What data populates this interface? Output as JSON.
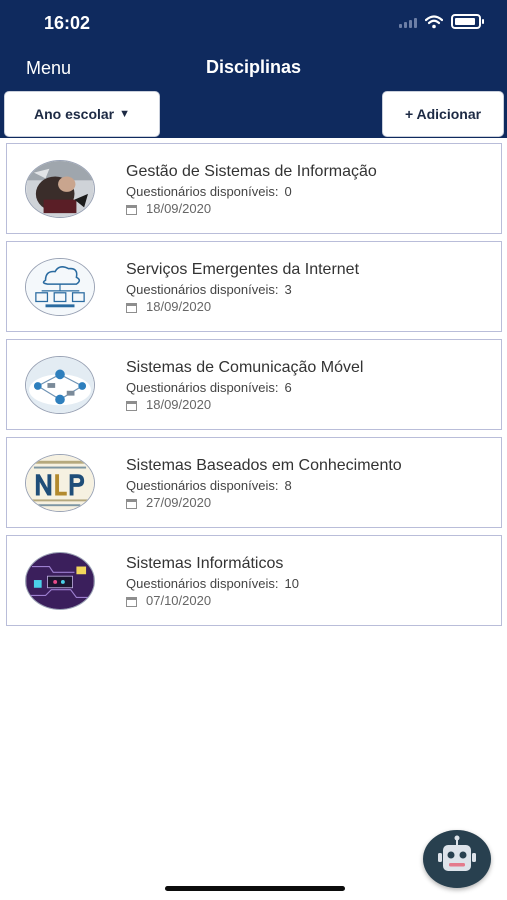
{
  "status_bar": {
    "time": "16:02"
  },
  "nav": {
    "menu_label": "Menu",
    "title": "Disciplinas"
  },
  "toolbar": {
    "filter_label": "Ano escolar",
    "add_label": "+ Adicionar"
  },
  "colors": {
    "header": "#0f2a5e",
    "card_border": "#b9bdd9",
    "fab": "#28404f"
  },
  "list_label": "Questionários disponíveis:",
  "items": [
    {
      "title": "Gestão de Sistemas de Informação",
      "count": "0",
      "date": "18/09/2020",
      "image": "business-graphic"
    },
    {
      "title": "Serviços Emergentes da Internet",
      "count": "3",
      "date": "18/09/2020",
      "image": "cloud-network-graphic"
    },
    {
      "title": "Sistemas de Comunicação Móvel",
      "count": "6",
      "date": "18/09/2020",
      "image": "mobile-network-graphic"
    },
    {
      "title": "Sistemas Baseados em Conhecimento",
      "count": "8",
      "date": "27/09/2020",
      "image": "nlp-wordcloud-graphic"
    },
    {
      "title": "Sistemas Informáticos",
      "count": "10",
      "date": "07/10/2020",
      "image": "circuit-board-graphic"
    }
  ]
}
